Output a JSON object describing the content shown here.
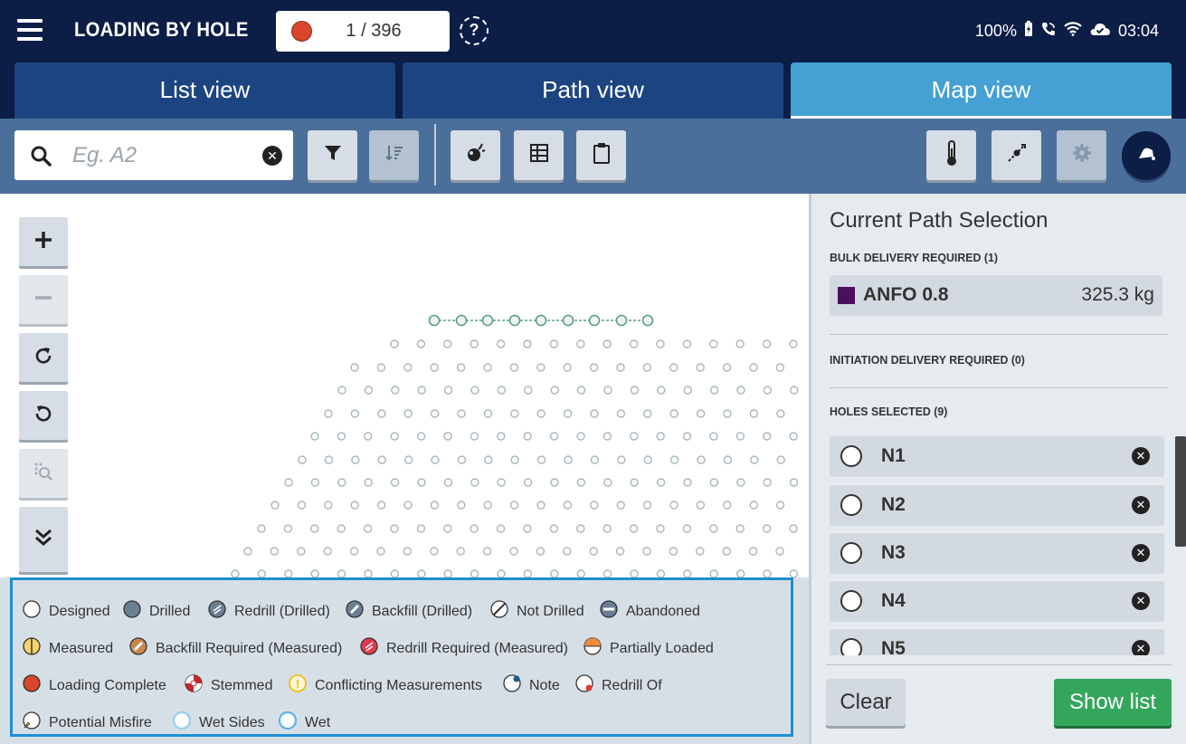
{
  "app": {
    "title": "LOADING BY HOLE",
    "counter": "1 / 396",
    "help_symbol": "?",
    "status": {
      "battery": "100%",
      "time": "03:04"
    }
  },
  "tabs": [
    {
      "label": "List view",
      "active": false
    },
    {
      "label": "Path view",
      "active": false
    },
    {
      "label": "Map view",
      "active": true
    }
  ],
  "search": {
    "placeholder": "Eg. A2",
    "value": ""
  },
  "toolbar_icons": [
    "filter-icon",
    "sort-icon",
    "blast-icon",
    "grid-icon",
    "clipboard-icon",
    "thermometer-icon",
    "measure-icon",
    "gear-icon",
    "bell-icon"
  ],
  "map_controls": [
    "zoom-in-icon",
    "zoom-out-icon",
    "rotate-cw-icon",
    "rotate-ccw-icon",
    "zoom-selection-icon",
    "collapse-icon"
  ],
  "legend": [
    {
      "label": "Designed",
      "icon": "designed"
    },
    {
      "label": "Drilled",
      "icon": "drilled"
    },
    {
      "label": "Redrill (Drilled)",
      "icon": "redrill-drilled"
    },
    {
      "label": "Backfill (Drilled)",
      "icon": "backfill-drilled"
    },
    {
      "label": "Not Drilled",
      "icon": "not-drilled"
    },
    {
      "label": "Abandoned",
      "icon": "abandoned"
    },
    {
      "label": "Measured",
      "icon": "measured"
    },
    {
      "label": "Backfill Required (Measured)",
      "icon": "backfill-required"
    },
    {
      "label": "Redrill Required (Measured)",
      "icon": "redrill-required"
    },
    {
      "label": "Partially Loaded",
      "icon": "partially-loaded"
    },
    {
      "label": "Loading Complete",
      "icon": "loading-complete"
    },
    {
      "label": "Stemmed",
      "icon": "stemmed"
    },
    {
      "label": "Conflicting Measurements",
      "icon": "conflicting"
    },
    {
      "label": "Note",
      "icon": "note"
    },
    {
      "label": "Redrill Of",
      "icon": "redrill-of"
    },
    {
      "label": "Potential Misfire",
      "icon": "misfire"
    },
    {
      "label": "Wet Sides",
      "icon": "wet-sides"
    },
    {
      "label": "Wet",
      "icon": "wet"
    }
  ],
  "panel": {
    "title": "Current Path Selection",
    "bulk_label": "BULK DELIVERY REQUIRED (1)",
    "bulk": {
      "name": "ANFO 0.8",
      "value": "325.3 kg",
      "color": "#4b0f5e"
    },
    "initiation_label": "INITIATION DELIVERY REQUIRED (0)",
    "holes_label": "HOLES SELECTED (9)",
    "holes": [
      "N1",
      "N2",
      "N3",
      "N4",
      "N5"
    ],
    "clear_label": "Clear",
    "show_list_label": "Show list"
  },
  "colors": {
    "header": "#0c1d46",
    "tab": "#1c4480",
    "tab_active": "#45a0d4",
    "toolbar": "#4b6f9b",
    "legend_border": "#1f8fd0",
    "show_list": "#33a65c",
    "path": "#5c9e86"
  }
}
